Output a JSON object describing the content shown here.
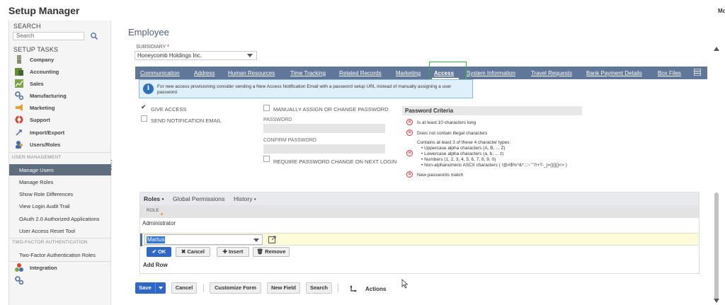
{
  "app": {
    "title": "Setup Manager",
    "top_right": "Mo"
  },
  "sidebar": {
    "search_header": "SEARCH",
    "search_placeholder": "Search",
    "tasks_header": "SETUP TASKS",
    "tasks": [
      {
        "label": "Company",
        "icon": "building-icon"
      },
      {
        "label": "Accounting",
        "icon": "ledger-icon"
      },
      {
        "label": "Sales",
        "icon": "chart-icon"
      },
      {
        "label": "Manufacturing",
        "icon": "gears-icon"
      },
      {
        "label": "Marketing",
        "icon": "megaphone-icon"
      },
      {
        "label": "Support",
        "icon": "lifebuoy-icon"
      },
      {
        "label": "Import/Export",
        "icon": "arrows-icon"
      },
      {
        "label": "Users/Roles",
        "icon": "users-icon"
      }
    ],
    "user_mgmt_label": "USER MANAGEMENT",
    "user_mgmt_items": [
      "Manage Users",
      "Manage Roles",
      "Show Role Differences",
      "View Login Audit Trail",
      "OAuth 2.0 Authorized Applications",
      "User Access Reset Tool"
    ],
    "active_item": "Manage Users",
    "twofa_label": "TWO-FACTOR AUTHENTICATION",
    "twofa_items": [
      "Two-Factor Authentication Roles"
    ],
    "integration_label": "Integration"
  },
  "main": {
    "title": "Employee",
    "subsidiary_label": "SUBSIDIARY",
    "subsidiary_required": "*",
    "subsidiary_value": "Honeycomb Holdings Inc.",
    "tabs": [
      "Communication",
      "Address",
      "Human Resources",
      "Time Tracking",
      "Related Records",
      "Marketing",
      "Access",
      "System Information",
      "Travel Requests",
      "Bank Payment Details",
      "Box Files"
    ],
    "active_tab": "Access"
  },
  "access": {
    "notice": "For new access provisioning consider sending a New Access Notification Email with a password setup URL instead of manually assigning a user password.",
    "give_access": "GIVE ACCESS",
    "send_notification": "SEND NOTIFICATION EMAIL",
    "manual_password": "MANUALLY ASSIGN OR CHANGE PASSWORD",
    "password_label": "PASSWORD",
    "confirm_label": "CONFIRM PASSWORD",
    "require_change": "REQUIRE PASSWORD CHANGE ON NEXT LOGIN",
    "criteria_header": "Password Criteria",
    "criteria_1": "Is at least 10 characters long",
    "criteria_2": "Does not contain illegal characters",
    "criteria_3_head": "Contains at least 3 of these 4 character types:",
    "criteria_3_items": [
      "• Uppercase alpha characters (A, B, ... Z)",
      "• Lowercase alpha characters (a, b, ... z)",
      "• Numbers (1, 2, 3, 4, 5, 6, 7, 8, 9, 0)",
      "• Non-alphanumeric ASCII characters ( !@#$%^&*.;:~`\"'/\\+?-_|=()[]{}<> )"
    ],
    "criteria_4": "New passwords match"
  },
  "roles": {
    "tabs": [
      "Roles •",
      "Global Permissions",
      "History •"
    ],
    "column_header": "ROLE",
    "rows": [
      "Administrator"
    ],
    "edit_value": "Martus",
    "btn_ok": "OK",
    "btn_cancel": "Cancel",
    "btn_insert": "Insert",
    "btn_remove": "Remove",
    "add_row": "Add Row"
  },
  "footer": {
    "save": "Save",
    "cancel": "Cancel",
    "customize": "Customize Form",
    "new_field": "New Field",
    "search": "Search",
    "actions": "Actions"
  },
  "colors": {
    "tabbar": "#607799",
    "primary_button": "#2f67c8",
    "active_sidebar": "#5f6d7f",
    "focus_outline": "#2fb34a"
  }
}
